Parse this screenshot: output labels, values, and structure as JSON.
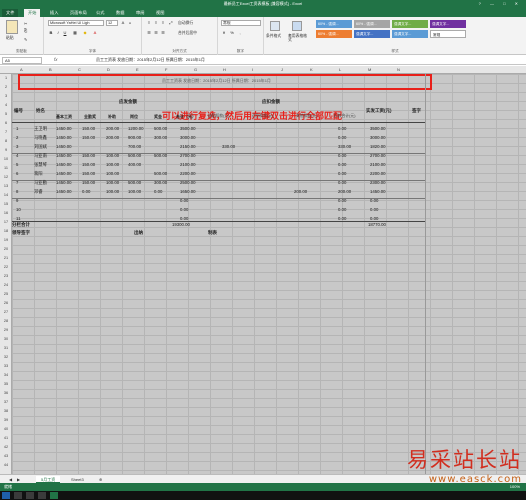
{
  "window": {
    "title": "最新员工Excel工资表模板 [兼容模式] - Excel",
    "buttons": [
      "?",
      "—",
      "□",
      "✕"
    ]
  },
  "tabs": [
    "文件",
    "开始",
    "插入",
    "页面布局",
    "公式",
    "数据",
    "审阅",
    "视图"
  ],
  "ribbon": {
    "clipboard": {
      "label": "剪贴板",
      "paste": "粘贴"
    },
    "font": {
      "label": "字体",
      "family": "Microsoft YaHei UI Ligh",
      "size": "12"
    },
    "alignment": {
      "label": "对齐方式",
      "wrap": "自动换行",
      "merge": "合并后居中"
    },
    "number": {
      "label": "数字",
      "format": "常规"
    },
    "styles": {
      "label": "样式",
      "conditional": "条件格式",
      "table": "套用表格格式",
      "chips": [
        {
          "text": "60% - 强调...",
          "color": "#5b9bd5"
        },
        {
          "text": "60% - 强调...",
          "color": "#ed7d31"
        },
        {
          "text": "60% - 强调...",
          "color": "#a5a5a5"
        },
        {
          "text": "强调文字...",
          "color": "#4472c4"
        },
        {
          "text": "强调文字...",
          "color": "#70ad47"
        },
        {
          "text": "强调文字...",
          "color": "#5b9bd5"
        },
        {
          "text": "强调文字...",
          "color": "#7030a0"
        },
        {
          "text": "常规",
          "color": "#ffffff"
        }
      ]
    }
  },
  "formula_bar": {
    "name_box": "A5",
    "fx": "fx",
    "content": "员工工资表   发放日期：2015年2月12日 所属日期：2015年1月"
  },
  "columns": [
    "A",
    "B",
    "C",
    "D",
    "E",
    "F",
    "G",
    "H",
    "I",
    "J",
    "K",
    "L",
    "M",
    "N"
  ],
  "rows": [
    "1",
    "2",
    "3",
    "4",
    "5",
    "6",
    "7",
    "8",
    "9",
    "10",
    "11",
    "12",
    "13",
    "14",
    "15",
    "16",
    "17",
    "18",
    "19",
    "20",
    "21",
    "22",
    "23",
    "24",
    "25",
    "26",
    "27",
    "28",
    "29",
    "30",
    "31",
    "32",
    "33",
    "34",
    "35",
    "36",
    "37",
    "38",
    "39",
    "40",
    "41",
    "42",
    "43",
    "44"
  ],
  "sheet": {
    "title_row": "员工工资表   发放日期：2015年2月12日 所属日期：2015年1月",
    "annotation": "可以进行复选，然后用左键双击进行全部匹配",
    "headers": {
      "no": "编号",
      "name": "姓名",
      "payable": "应发金额",
      "deduct": "应扣金额",
      "net": "实发工资(元)",
      "sign": "签字",
      "sub": [
        "基本工资",
        "全勤奖",
        "补助",
        "岗位",
        "奖金",
        "合计（元）"
      ],
      "deduct_sub": [
        "缺勤扣款(元)",
        "迟到扣款(元)",
        "其他扣款(元)",
        "扣款合计(元)"
      ]
    },
    "employees": [
      {
        "no": "1",
        "name": "王卫明",
        "base": "1450.00",
        "att": "150.00",
        "sub": "200.00",
        "post": "1200.00",
        "bonus": "500.00",
        "total": "3500.00",
        "late": "",
        "other": "",
        "ded": "0.00",
        "net": "3500.00"
      },
      {
        "no": "2",
        "name": "马晓鑫",
        "base": "1450.00",
        "att": "150.00",
        "sub": "200.00",
        "post": "900.00",
        "bonus": "300.00",
        "total": "3000.00",
        "late": "",
        "other": "",
        "ded": "0.00",
        "net": "3000.00"
      },
      {
        "no": "3",
        "name": "刘国斌",
        "base": "1450.00",
        "att": "",
        "sub": "",
        "post": "700.00",
        "bonus": "",
        "total": "2150.00",
        "late": "330.00",
        "other": "",
        "ded": "330.00",
        "net": "1820.00"
      },
      {
        "no": "4",
        "name": "马亚南",
        "base": "1450.00",
        "att": "150.00",
        "sub": "100.00",
        "post": "500.00",
        "bonus": "500.00",
        "total": "2700.00",
        "late": "",
        "other": "",
        "ded": "0.00",
        "net": "2700.00"
      },
      {
        "no": "5",
        "name": "张慧琴",
        "base": "1450.00",
        "att": "150.00",
        "sub": "100.00",
        "post": "400.00",
        "bonus": "",
        "total": "2100.00",
        "late": "",
        "other": "",
        "ded": "0.00",
        "net": "2100.00"
      },
      {
        "no": "6",
        "name": "蒋阳",
        "base": "1450.00",
        "att": "150.00",
        "sub": "100.00",
        "post": "",
        "bonus": "500.00",
        "total": "2200.00",
        "late": "",
        "other": "",
        "ded": "0.00",
        "net": "2200.00"
      },
      {
        "no": "7",
        "name": "马亚勤",
        "base": "1450.00",
        "att": "150.00",
        "sub": "100.00",
        "post": "500.00",
        "bonus": "300.00",
        "total": "2500.00",
        "late": "",
        "other": "",
        "ded": "0.00",
        "net": "2300.00"
      },
      {
        "no": "8",
        "name": "邓睿",
        "base": "1450.00",
        "att": "0.00",
        "sub": "100.00",
        "post": "100.00",
        "bonus": "0.00",
        "total": "1650.00",
        "late": "",
        "other": "200.00",
        "ded": "200.00",
        "net": "1450.00"
      },
      {
        "no": "9",
        "name": "",
        "base": "",
        "att": "",
        "sub": "",
        "post": "",
        "bonus": "",
        "total": "0.00",
        "late": "",
        "other": "",
        "ded": "0.00",
        "net": "0.00"
      },
      {
        "no": "10",
        "name": "",
        "base": "",
        "att": "",
        "sub": "",
        "post": "",
        "bonus": "",
        "total": "0.00",
        "late": "",
        "other": "",
        "ded": "0.00",
        "net": "0.00"
      },
      {
        "no": "11",
        "name": "",
        "base": "",
        "att": "",
        "sub": "",
        "post": "",
        "bonus": "",
        "total": "0.00",
        "late": "",
        "other": "",
        "ded": "0.00",
        "net": "0.00"
      }
    ],
    "subtotal_label": "分栏合计",
    "subtotal_total": "19300.00",
    "subtotal_net": "18770.00",
    "footer": {
      "leader": "领导签字",
      "cashier": "出纳",
      "maker": "制表"
    }
  },
  "sheet_tabs": [
    "5月工资",
    "Sheet3"
  ],
  "status": {
    "ready": "就绪",
    "zoom": "100%"
  },
  "watermark": {
    "main": "易采站长站",
    "url": "www.easck.com"
  }
}
